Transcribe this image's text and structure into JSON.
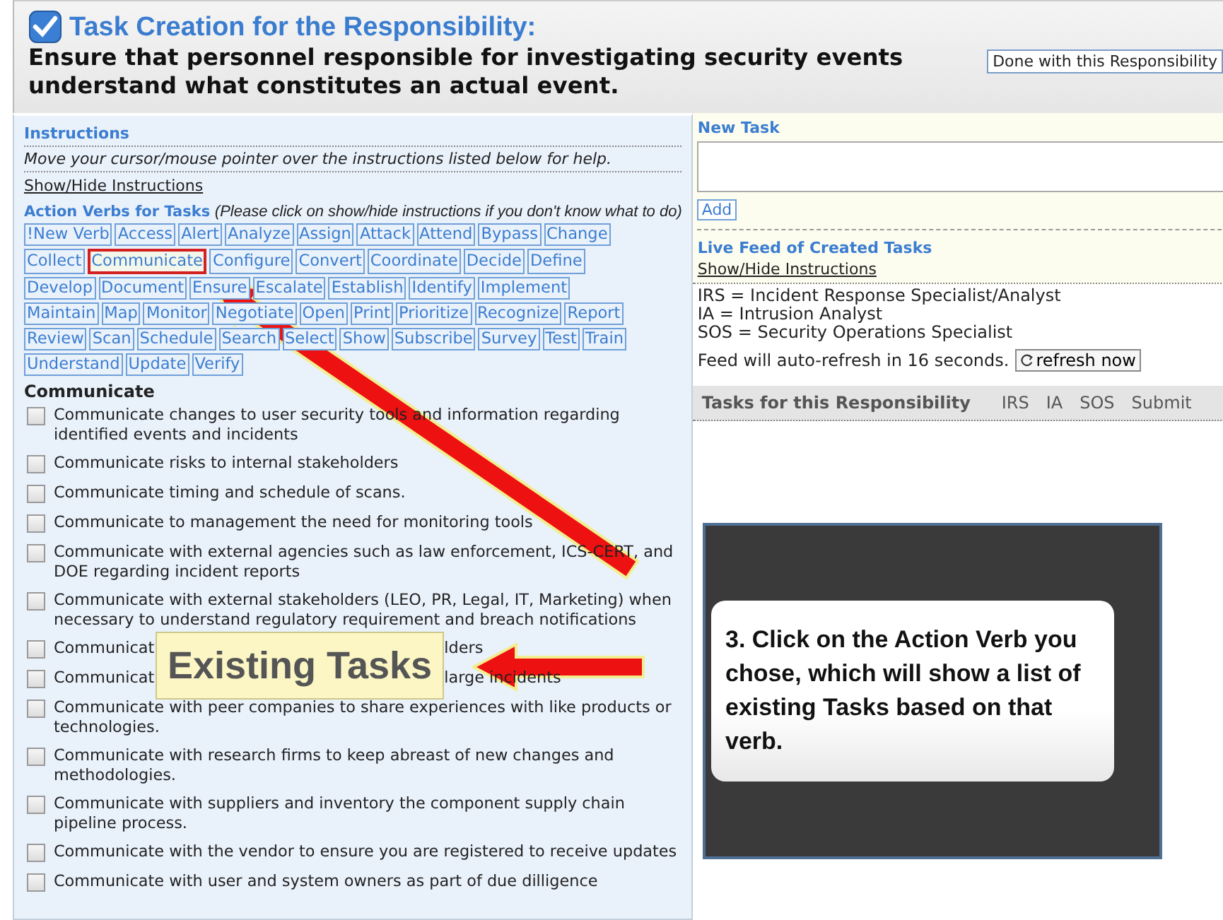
{
  "header": {
    "title": "Task Creation for the Responsibility:",
    "responsibility": "Ensure that personnel responsible for investigating security events understand what constitutes an actual event.",
    "done_button": "Done with this Responsibility"
  },
  "instructions": {
    "heading": "Instructions",
    "hint": "Move your cursor/mouse pointer over the instructions listed below for help.",
    "toggle_link": "Show/Hide Instructions"
  },
  "action_verbs": {
    "heading": "Action Verbs for Tasks",
    "note": "(Please click on show/hide instructions if you don't know what to do)",
    "verbs": [
      {
        "label": "!New Verb",
        "selected": false
      },
      {
        "label": "Access",
        "selected": false
      },
      {
        "label": "Alert",
        "selected": false
      },
      {
        "label": "Analyze",
        "selected": false
      },
      {
        "label": "Assign",
        "selected": false
      },
      {
        "label": "Attack",
        "selected": false
      },
      {
        "label": "Attend",
        "selected": false
      },
      {
        "label": "Bypass",
        "selected": false
      },
      {
        "label": "Change",
        "selected": false
      },
      {
        "label": "Collect",
        "selected": false
      },
      {
        "label": "Communicate",
        "selected": true
      },
      {
        "label": "Configure",
        "selected": false
      },
      {
        "label": "Convert",
        "selected": false
      },
      {
        "label": "Coordinate",
        "selected": false
      },
      {
        "label": "Decide",
        "selected": false
      },
      {
        "label": "Define",
        "selected": false
      },
      {
        "label": "Develop",
        "selected": false
      },
      {
        "label": "Document",
        "selected": false
      },
      {
        "label": "Ensure",
        "selected": false
      },
      {
        "label": "Escalate",
        "selected": false
      },
      {
        "label": "Establish",
        "selected": false
      },
      {
        "label": "Identify",
        "selected": false
      },
      {
        "label": "Implement",
        "selected": false
      },
      {
        "label": "Maintain",
        "selected": false
      },
      {
        "label": "Map",
        "selected": false
      },
      {
        "label": "Monitor",
        "selected": false
      },
      {
        "label": "Negotiate",
        "selected": false
      },
      {
        "label": "Open",
        "selected": false
      },
      {
        "label": "Print",
        "selected": false
      },
      {
        "label": "Prioritize",
        "selected": false
      },
      {
        "label": "Recognize",
        "selected": false
      },
      {
        "label": "Report",
        "selected": false
      },
      {
        "label": "Review",
        "selected": false
      },
      {
        "label": "Scan",
        "selected": false
      },
      {
        "label": "Schedule",
        "selected": false
      },
      {
        "label": "Search",
        "selected": false
      },
      {
        "label": "Select",
        "selected": false
      },
      {
        "label": "Show",
        "selected": false
      },
      {
        "label": "Subscribe",
        "selected": false
      },
      {
        "label": "Survey",
        "selected": false
      },
      {
        "label": "Test",
        "selected": false
      },
      {
        "label": "Train",
        "selected": false
      },
      {
        "label": "Understand",
        "selected": false
      },
      {
        "label": "Update",
        "selected": false
      },
      {
        "label": "Verify",
        "selected": false
      }
    ]
  },
  "existing_tasks": {
    "heading": "Communicate",
    "tasks": [
      {
        "text": "Communicate changes to user security tools and information regarding identified events and incidents",
        "checked": false
      },
      {
        "text": "Communicate risks to internal stakeholders",
        "checked": false
      },
      {
        "text": "Communicate timing and schedule of scans.",
        "checked": false
      },
      {
        "text": "Communicate to management the need for monitoring tools",
        "checked": false
      },
      {
        "text": "Communicate with external agencies such as law enforcement, ICS-CERT, and DOE regarding incident reports",
        "checked": false
      },
      {
        "text": "Communicate with external stakeholders (LEO, PR, Legal, IT, Marketing) when necessary to understand regulatory requirement and breach notifications",
        "checked": false
      },
      {
        "text": "Communicat",
        "tail": "lders",
        "checked": false
      },
      {
        "text": "Communicat",
        "tail": "large incidents",
        "checked": false
      },
      {
        "text": "Communicate with peer companies to share experiences with like products or technologies.",
        "checked": false
      },
      {
        "text": "Communicate with research firms to keep abreast of new changes and methodologies.",
        "checked": false
      },
      {
        "text": "Communicate with suppliers and inventory the component supply chain pipeline process.",
        "checked": false
      },
      {
        "text": "Communicate with the vendor to ensure you are registered to receive updates",
        "checked": false
      },
      {
        "text": "Communicate with user and system owners as part of due dilligence",
        "checked": false
      }
    ]
  },
  "new_task": {
    "label": "New Task",
    "add_button": "Add"
  },
  "live_feed": {
    "heading": "Live Feed of Created Tasks",
    "toggle_link": "Show/Hide Instructions",
    "legend": [
      "IRS = Incident Response Specialist/Analyst",
      "IA = Intrusion Analyst",
      "SOS = Security Operations Specialist"
    ],
    "refresh_note": "Feed will auto-refresh in 16 seconds.",
    "refresh_button": "refresh now"
  },
  "table": {
    "columns": [
      "Tasks for this Responsibility",
      "IRS",
      "IA",
      "SOS",
      "Submit"
    ]
  },
  "annotations": {
    "label_callout": "Existing Tasks",
    "step_callout": "3. Click on the Action Verb you chose, which will show a list of existing Tasks based on that verb."
  }
}
